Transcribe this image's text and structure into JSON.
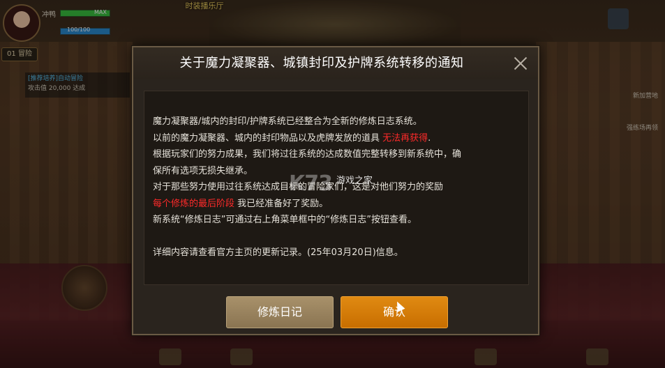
{
  "hud": {
    "player_name": "冲鸭",
    "hp_label": "MAX",
    "hp_fraction": 1.0,
    "mp_text": "100/100",
    "mp_fraction": 1.0,
    "tag_button": "01 冒险",
    "top_banner": "时装播乐厅",
    "quest_title": "[推荐培养]自动冒险",
    "quest_desc": "攻击值 20,000 达成",
    "right_text_1": "新加营地",
    "right_text_2": "强练场再领"
  },
  "dialog": {
    "title": "关于魔力凝聚器、城镇封印及护牌系统转移的通知",
    "lines": [
      {
        "text": "魔力凝聚器/城内的封印/护牌系统已经整合为全新的修炼日志系统。",
        "red": ""
      },
      {
        "text": "以前的魔力凝聚器、城内的封印物品以及虎牌发放的道具 ",
        "red": "无法再获得",
        "tail": "."
      },
      {
        "text": "根据玩家们的努力成果，我们将过往系统的达成数值完整转移到新系统中，确",
        "red": ""
      },
      {
        "text": "保所有选项无损失继承。",
        "red": ""
      },
      {
        "text": "对于那些努力使用过往系统达成目标的冒险家们，这是对他们努力的奖励",
        "red": ""
      },
      {
        "pre_red": "每个修炼的最后阶段",
        "text": " 我已经准备好了奖励。"
      },
      {
        "text": "新系统“修炼日志”可通过右上角菜单框中的“修炼日志”按钮查看。",
        "red": ""
      },
      {
        "text": "",
        "red": ""
      },
      {
        "text": "详细内容请查看官方主页的更新记录。(25年03月20日)信息。",
        "red": ""
      }
    ],
    "journal_button": "修炼日记",
    "confirm_button": "确认"
  },
  "watermark": {
    "logo": "K73",
    "text": "游戏之家"
  },
  "colors": {
    "accent_orange": "#e08a12",
    "warning_red": "#ff2a2a",
    "panel_bg": "#1e1914"
  }
}
